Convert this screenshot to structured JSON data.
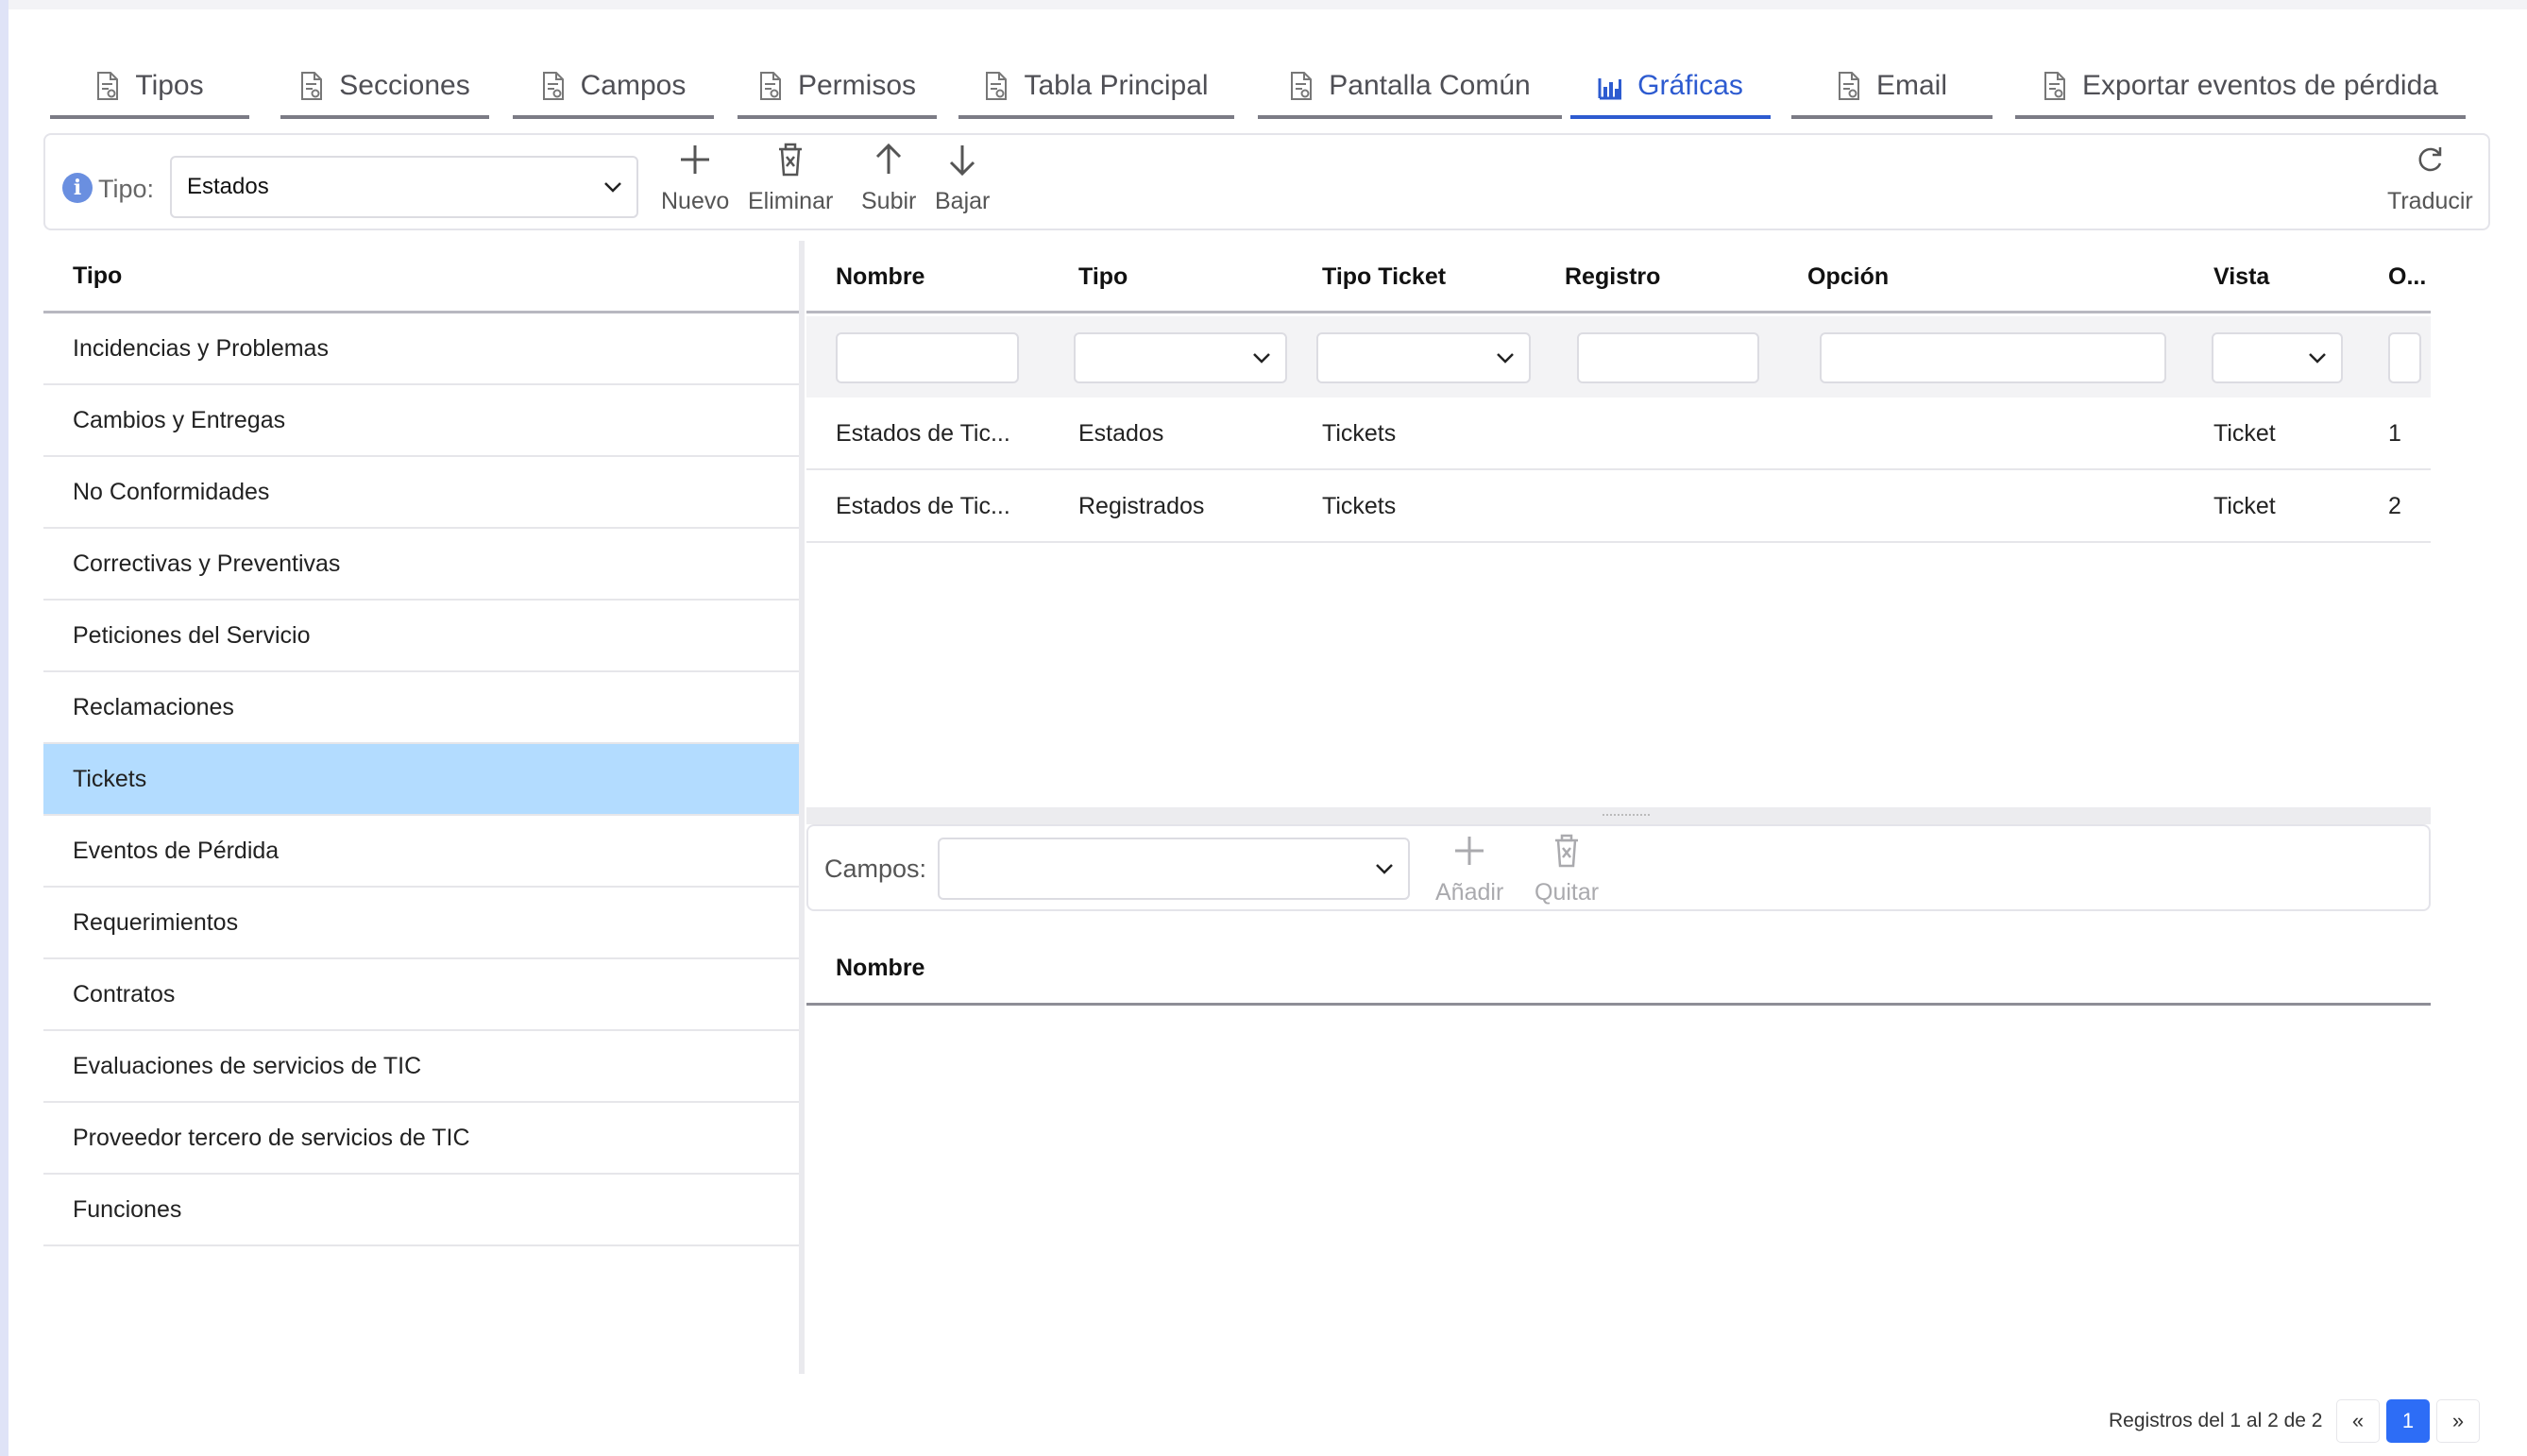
{
  "tabs": [
    {
      "label": "Tipos",
      "icon": "document-gear-icon",
      "active": false
    },
    {
      "label": "Secciones",
      "icon": "document-gear-icon",
      "active": false
    },
    {
      "label": "Campos",
      "icon": "document-gear-icon",
      "active": false
    },
    {
      "label": "Permisos",
      "icon": "document-gear-icon",
      "active": false
    },
    {
      "label": "Tabla Principal",
      "icon": "document-gear-icon",
      "active": false
    },
    {
      "label": "Pantalla Común",
      "icon": "document-gear-icon",
      "active": false
    },
    {
      "label": "Gráficas",
      "icon": "bar-chart-icon",
      "active": true
    },
    {
      "label": "Email",
      "icon": "document-gear-icon",
      "active": false
    },
    {
      "label": "Exportar eventos de pérdida",
      "icon": "document-gear-icon",
      "active": false
    }
  ],
  "toolbar": {
    "tipo_label": "Tipo:",
    "tipo_value": "Estados",
    "nuevo": "Nuevo",
    "eliminar": "Eliminar",
    "subir": "Subir",
    "bajar": "Bajar",
    "traducir": "Traducir"
  },
  "left_panel": {
    "header": "Tipo",
    "items": [
      "Incidencias y Problemas",
      "Cambios y Entregas",
      "No Conformidades",
      "Correctivas y Preventivas",
      "Peticiones del Servicio",
      "Reclamaciones",
      "Tickets",
      "Eventos de Pérdida",
      "Requerimientos",
      "Contratos",
      "Evaluaciones de servicios de TIC",
      "Proveedor tercero de servicios de TIC",
      "Funciones"
    ],
    "selected": "Tickets"
  },
  "grid": {
    "columns": [
      "Nombre",
      "Tipo",
      "Tipo Ticket",
      "Registro",
      "Opción",
      "Vista",
      "O..."
    ],
    "rows": [
      {
        "nombre": "Estados de Tic...",
        "tipo": "Estados",
        "tipo_ticket": "Tickets",
        "registro": "",
        "opcion": "",
        "vista": "Ticket",
        "orden": "1"
      },
      {
        "nombre": "Estados de Tic...",
        "tipo": "Registrados",
        "tipo_ticket": "Tickets",
        "registro": "",
        "opcion": "",
        "vista": "Ticket",
        "orden": "2"
      }
    ]
  },
  "campos_bar": {
    "label": "Campos:",
    "value": "",
    "anadir": "Añadir",
    "quitar": "Quitar"
  },
  "bottom_grid": {
    "header": "Nombre"
  },
  "pager": {
    "summary": "Registros del 1 al 2 de 2",
    "prev": "«",
    "current": "1",
    "next": "»"
  },
  "colors": {
    "accent": "#2d5bd0",
    "selected_row": "#b3dcff",
    "pager_active": "#2d6df6"
  }
}
